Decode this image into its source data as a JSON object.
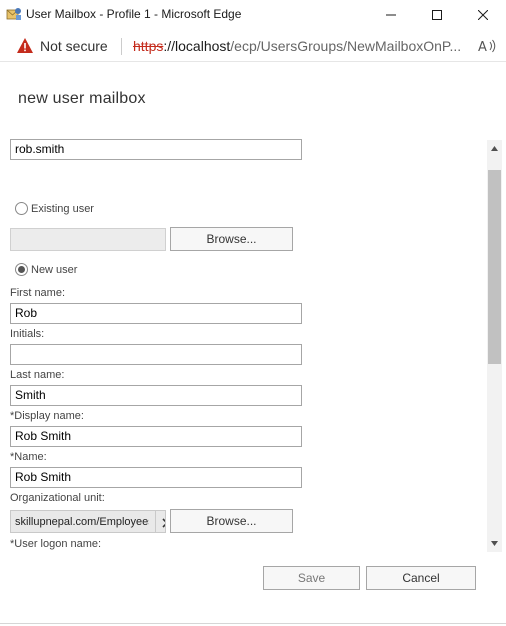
{
  "window": {
    "title": "User Mailbox - Profile 1 - Microsoft Edge"
  },
  "addressbar": {
    "security_label": "Not secure",
    "url_scheme": "https",
    "url_host": "://localhost",
    "url_path": "/ecp/UsersGroups/NewMailboxOnP..."
  },
  "page": {
    "title": "new user mailbox"
  },
  "form": {
    "alias_value": "rob.smith",
    "existing_user_label": "Existing user",
    "existing_user_browse": "Browse...",
    "new_user_label": "New user",
    "first_name_label": "First name:",
    "first_name_value": "Rob",
    "initials_label": "Initials:",
    "initials_value": "",
    "last_name_label": "Last name:",
    "last_name_value": "Smith",
    "display_name_label": "*Display name:",
    "display_name_value": "Rob Smith",
    "name_label": "*Name:",
    "name_value": "Rob Smith",
    "ou_label": "Organizational unit:",
    "ou_value": "skillupnepal.com/Employees",
    "ou_browse": "Browse...",
    "logon_name_label": "*User logon name:"
  },
  "footer": {
    "save_label": "Save",
    "cancel_label": "Cancel"
  },
  "colors": {
    "insecure_red": "#c42b1c",
    "field_border": "#a6a6a6",
    "scroll_thumb": "#c1c1c1"
  }
}
